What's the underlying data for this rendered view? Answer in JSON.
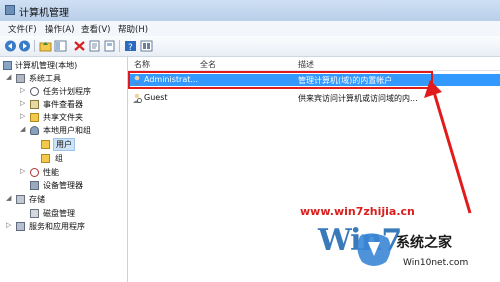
{
  "window": {
    "title": "计算机管理"
  },
  "menu": [
    "文件(F)",
    "操作(A)",
    "查看(V)",
    "帮助(H)"
  ],
  "toolbar": [
    "back",
    "forward",
    "up",
    "show-hide",
    "delete",
    "properties",
    "export",
    "help",
    "view"
  ],
  "tree": {
    "root": "计算机管理(本地)",
    "system_tools": "系统工具",
    "task_scheduler": "任务计划程序",
    "event_viewer": "事件查看器",
    "shared_folders": "共享文件夹",
    "local_users_groups": "本地用户和组",
    "users": "用户",
    "groups": "组",
    "performance": "性能",
    "device_manager": "设备管理器",
    "storage": "存储",
    "disk_management": "磁盘管理",
    "services_apps": "服务和应用程序"
  },
  "columns": {
    "name": "名称",
    "fullname": "全名",
    "description": "描述"
  },
  "rows": [
    {
      "name": "Administrat...",
      "fullname": "",
      "description": "管理计算机(域)的内置帐户"
    },
    {
      "name": "Guest",
      "fullname": "",
      "description": "供来宾访问计算机或访问域的内..."
    }
  ],
  "watermark": {
    "url": "www.win7zhijia.cn",
    "site": "系统之家",
    "url2": "Win10net.com"
  },
  "colors": {
    "highlight": "#3399ff",
    "annotation": "#e11b1b"
  }
}
